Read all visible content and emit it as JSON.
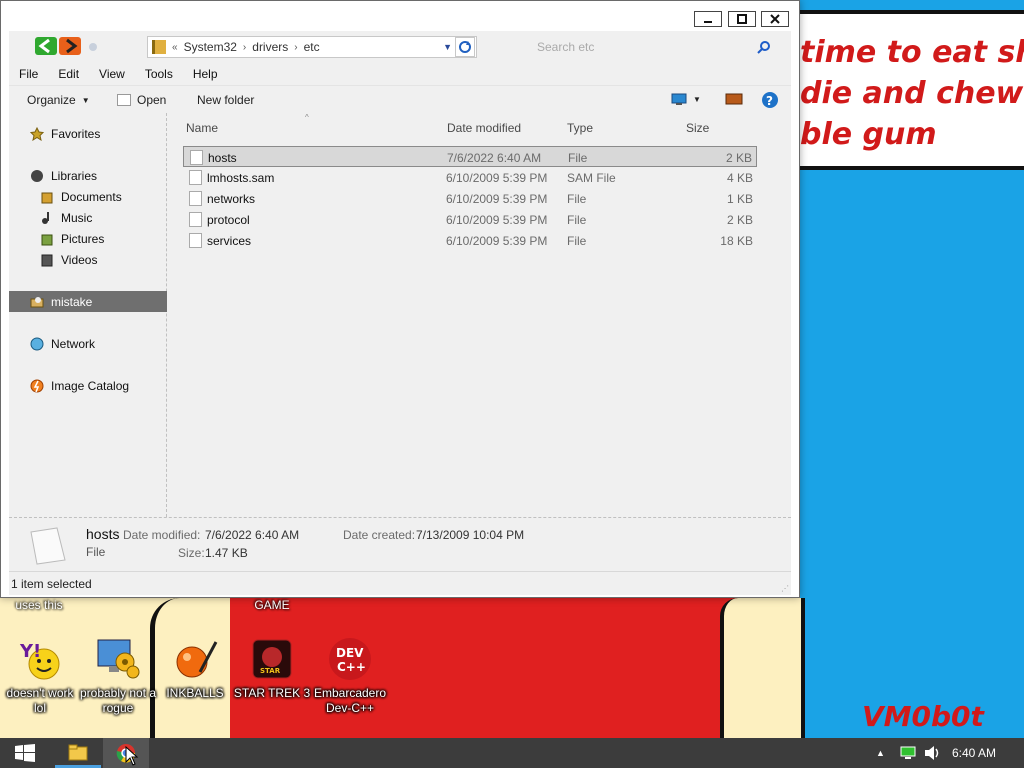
{
  "window": {
    "breadcrumb": [
      "System32",
      "drivers",
      "etc"
    ],
    "breadcrumb_prefix": "«",
    "search_placeholder": "Search etc",
    "controls": {
      "minimize": "–",
      "maximize": "□",
      "close": "✕"
    }
  },
  "menu": [
    "File",
    "Edit",
    "View",
    "Tools",
    "Help"
  ],
  "toolbar": {
    "organize": "Organize",
    "open": "Open",
    "new_folder": "New folder"
  },
  "sidebar": {
    "favorites": "Favorites",
    "libraries": "Libraries",
    "documents": "Documents",
    "music": "Music",
    "pictures": "Pictures",
    "videos": "Videos",
    "mistake": "mistake",
    "network": "Network",
    "image_catalog": "Image Catalog"
  },
  "columns": {
    "name": "Name",
    "date": "Date modified",
    "type": "Type",
    "size": "Size"
  },
  "files": [
    {
      "name": "hosts",
      "date": "7/6/2022 6:40 AM",
      "type": "File",
      "size": "2 KB"
    },
    {
      "name": "lmhosts.sam",
      "date": "6/10/2009 5:39 PM",
      "type": "SAM File",
      "size": "4 KB"
    },
    {
      "name": "networks",
      "date": "6/10/2009 5:39 PM",
      "type": "File",
      "size": "1 KB"
    },
    {
      "name": "protocol",
      "date": "6/10/2009 5:39 PM",
      "type": "File",
      "size": "2 KB"
    },
    {
      "name": "services",
      "date": "6/10/2009 5:39 PM",
      "type": "File",
      "size": "18 KB"
    }
  ],
  "details": {
    "name": "hosts",
    "type": "File",
    "modified_label": "Date modified:",
    "modified": "7/6/2022 6:40 AM",
    "created_label": "Date created:",
    "created": "7/13/2009 10:04 PM",
    "size_label": "Size:",
    "size": "1.47 KB"
  },
  "status": "1 item selected",
  "desktop": {
    "wallpaper_text": "time to eat shit\ndie and chew\nble gum",
    "signature": "VM0b0t",
    "partial_labels": {
      "uses_this": "uses this",
      "game": "GAME"
    },
    "icons": [
      {
        "label": "doesn't work lol"
      },
      {
        "label": "probably not a rogue"
      },
      {
        "label": "INKBALLS"
      },
      {
        "label": "STAR TREK 3"
      },
      {
        "label": "Embarcadero Dev-C++"
      }
    ]
  },
  "taskbar": {
    "clock": "6:40 AM"
  },
  "colors": {
    "accent_blue": "#1e72c8",
    "selection_gray": "#6f6f6f",
    "wallpaper_red": "#e02020",
    "wallpaper_sky": "#1aa3e6"
  }
}
